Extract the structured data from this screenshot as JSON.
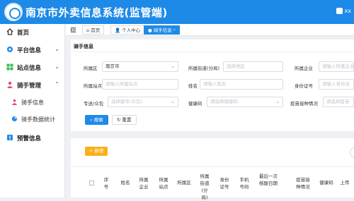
{
  "header": {
    "title": "南京市外卖信息系统(监管端)",
    "right_text": "xx"
  },
  "sidebar": {
    "items": [
      {
        "label": "首页",
        "icon": "home-icon"
      },
      {
        "label": "平台信息",
        "icon": "platform-icon",
        "chevron": "⌄"
      },
      {
        "label": "站点信息",
        "icon": "site-icon",
        "chevron": "⌄"
      },
      {
        "label": "骑手管理",
        "icon": "rider-icon",
        "chevron": "⌃"
      },
      {
        "label": "预警信息",
        "icon": "warning-icon",
        "chevron": "⌄"
      }
    ],
    "subitems": [
      {
        "label": "骑手信息",
        "icon": "rider-info-icon"
      },
      {
        "label": "骑手数据统计",
        "icon": "rider-stats-icon"
      }
    ]
  },
  "tabs": {
    "home": "首页",
    "personal": "个人中心",
    "rider": "骑手信息"
  },
  "panel": {
    "title": "骑手信息",
    "fields": {
      "district_label": "所属区",
      "district_value": "南京市",
      "street_label": "所属街道(分局)",
      "street_placeholder": "选择地区",
      "company_label": "所属企业",
      "company_placeholder": "请输入所属企业",
      "station_label": "所属站点",
      "station_placeholder": "请输入所属站点",
      "name_label": "姓名",
      "name_placeholder": "请输入姓名",
      "id_label": "身份证号",
      "id_placeholder": "请输入身份证",
      "delivery_label": "专送/众包",
      "delivery_placeholder": "选择服专(众包)",
      "healthcode_label": "健康码",
      "healthcode_placeholder": "请选择健康码",
      "vaccine_label": "疫苗接种情况",
      "vaccine_placeholder": "请选择疫苗"
    },
    "buttons": {
      "search": "搜索",
      "reset": "重置"
    }
  },
  "table": {
    "add_button": "+ 新增",
    "columns": [
      "序号",
      "姓名",
      "所属企业",
      "所属站点",
      "所属区",
      "所属街道(分局)",
      "身份证号",
      "手机号码",
      "最后一次核酸日期",
      "疫苗接种情况",
      "健康码",
      "上传"
    ]
  }
}
